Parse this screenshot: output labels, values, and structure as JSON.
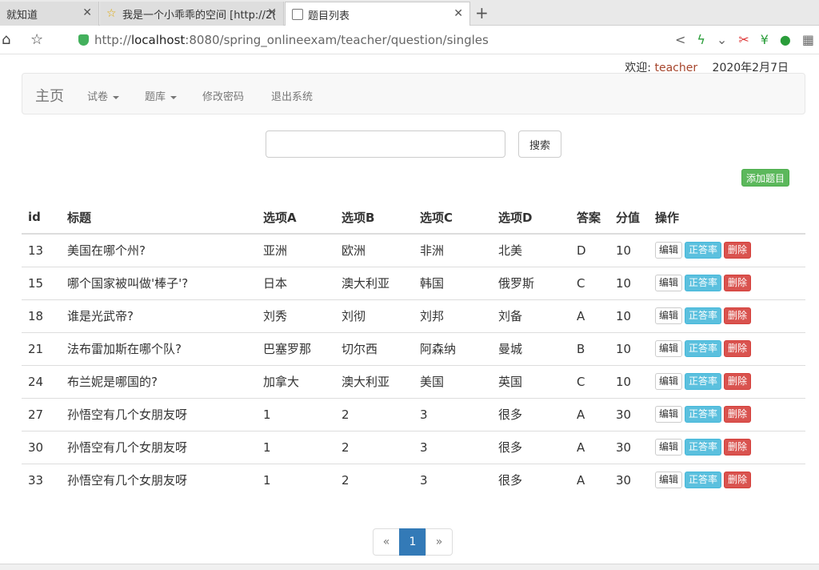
{
  "browser": {
    "tabs": [
      {
        "label": "就知道"
      },
      {
        "label": "我是一个小乖乖的空间 [http://2("
      },
      {
        "label": "题目列表"
      }
    ],
    "url_prefix": "http://",
    "url_host": "localhost",
    "url_rest": ":8080/spring_onlineexam/teacher/question/singles"
  },
  "header": {
    "welcome_label": "欢迎:",
    "username": "teacher",
    "date": "2020年2月7日"
  },
  "navbar": {
    "brand": "主页",
    "items": [
      {
        "label": "试卷",
        "dropdown": true
      },
      {
        "label": "题库",
        "dropdown": true
      },
      {
        "label": "修改密码"
      },
      {
        "label": "退出系统"
      }
    ]
  },
  "search": {
    "value": "",
    "button_label": "搜索"
  },
  "add_button_label": "添加题目",
  "table": {
    "headers": [
      "id",
      "标题",
      "选项A",
      "选项B",
      "选项C",
      "选项D",
      "答案",
      "分值",
      "操作"
    ],
    "rows": [
      {
        "id": "13",
        "title": "美国在哪个州?",
        "a": "亚洲",
        "b": "欧洲",
        "c": "非洲",
        "d": "北美",
        "answer": "D",
        "score": "10"
      },
      {
        "id": "15",
        "title": "哪个国家被叫做'棒子'?",
        "a": "日本",
        "b": "澳大利亚",
        "c": "韩国",
        "d": "俄罗斯",
        "answer": "C",
        "score": "10"
      },
      {
        "id": "18",
        "title": "谁是光武帝?",
        "a": "刘秀",
        "b": "刘彻",
        "c": "刘邦",
        "d": "刘备",
        "answer": "A",
        "score": "10"
      },
      {
        "id": "21",
        "title": "法布雷加斯在哪个队?",
        "a": "巴塞罗那",
        "b": "切尔西",
        "c": "阿森纳",
        "d": "曼城",
        "answer": "B",
        "score": "10"
      },
      {
        "id": "24",
        "title": "布兰妮是哪国的?",
        "a": "加拿大",
        "b": "澳大利亚",
        "c": "美国",
        "d": "英国",
        "answer": "C",
        "score": "10"
      },
      {
        "id": "27",
        "title": "孙悟空有几个女朋友呀",
        "a": "1",
        "b": "2",
        "c": "3",
        "d": "很多",
        "answer": "A",
        "score": "30"
      },
      {
        "id": "30",
        "title": "孙悟空有几个女朋友呀",
        "a": "1",
        "b": "2",
        "c": "3",
        "d": "很多",
        "answer": "A",
        "score": "30"
      },
      {
        "id": "33",
        "title": "孙悟空有几个女朋友呀",
        "a": "1",
        "b": "2",
        "c": "3",
        "d": "很多",
        "answer": "A",
        "score": "30"
      }
    ],
    "actions": {
      "edit": "编辑",
      "rate": "正答率",
      "delete": "删除"
    }
  },
  "pagination": {
    "prev": "«",
    "current": "1",
    "next": "»"
  },
  "colors": {
    "link": "#337ab7",
    "success": "#5cb85c",
    "info": "#5bc0de",
    "danger": "#d9534f",
    "username": "#a6452c"
  }
}
